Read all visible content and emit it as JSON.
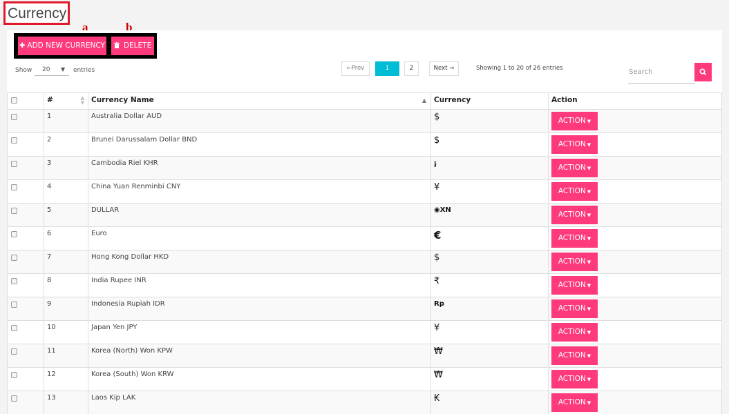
{
  "page_title": "Currency",
  "annotations": {
    "a": "a",
    "b": "b"
  },
  "toolbar": {
    "add_label": "ADD NEW CURRENCY",
    "delete_label": "DELETE"
  },
  "length_menu": {
    "show": "Show",
    "value": "20",
    "entries": "entries"
  },
  "pagination": {
    "prev": "←Prev",
    "pages": [
      "1",
      "2"
    ],
    "next": "Next →",
    "info": "Showing 1 to 20 of 26 entries"
  },
  "search": {
    "placeholder": "Search"
  },
  "table": {
    "headers": {
      "num": "#",
      "name": "Currency Name",
      "currency": "Currency",
      "action": "Action"
    },
    "action_label": "ACTION",
    "rows": [
      {
        "num": "1",
        "name": "Australia Dollar AUD",
        "symbol": "$"
      },
      {
        "num": "2",
        "name": "Brunei Darussalam Dollar BND",
        "symbol": "$"
      },
      {
        "num": "3",
        "name": "Cambodia Riel KHR",
        "symbol": "៛"
      },
      {
        "num": "4",
        "name": "China Yuan Renminbi CNY",
        "symbol": "¥"
      },
      {
        "num": "5",
        "name": "DULLAR",
        "symbol": "◉XN"
      },
      {
        "num": "6",
        "name": "Euro",
        "symbol": "€"
      },
      {
        "num": "7",
        "name": "Hong Kong Dollar HKD",
        "symbol": "$"
      },
      {
        "num": "8",
        "name": "India Rupee INR",
        "symbol": "₹"
      },
      {
        "num": "9",
        "name": "Indonesia Rupiah IDR",
        "symbol": "Rp"
      },
      {
        "num": "10",
        "name": "Japan Yen JPY",
        "symbol": "¥"
      },
      {
        "num": "11",
        "name": "Korea (North) Won KPW",
        "symbol": "₩"
      },
      {
        "num": "12",
        "name": "Korea (South) Won KRW",
        "symbol": "₩"
      },
      {
        "num": "13",
        "name": "Laos Kip LAK",
        "symbol": "₭"
      }
    ]
  },
  "colors": {
    "accent": "#ff3a7c",
    "active_page": "#00bcd4",
    "highlight": "#e0182b"
  },
  "icons": {
    "add": "plus-icon",
    "delete": "trash-icon",
    "search": "search-icon",
    "caret": "caret-down-icon"
  }
}
